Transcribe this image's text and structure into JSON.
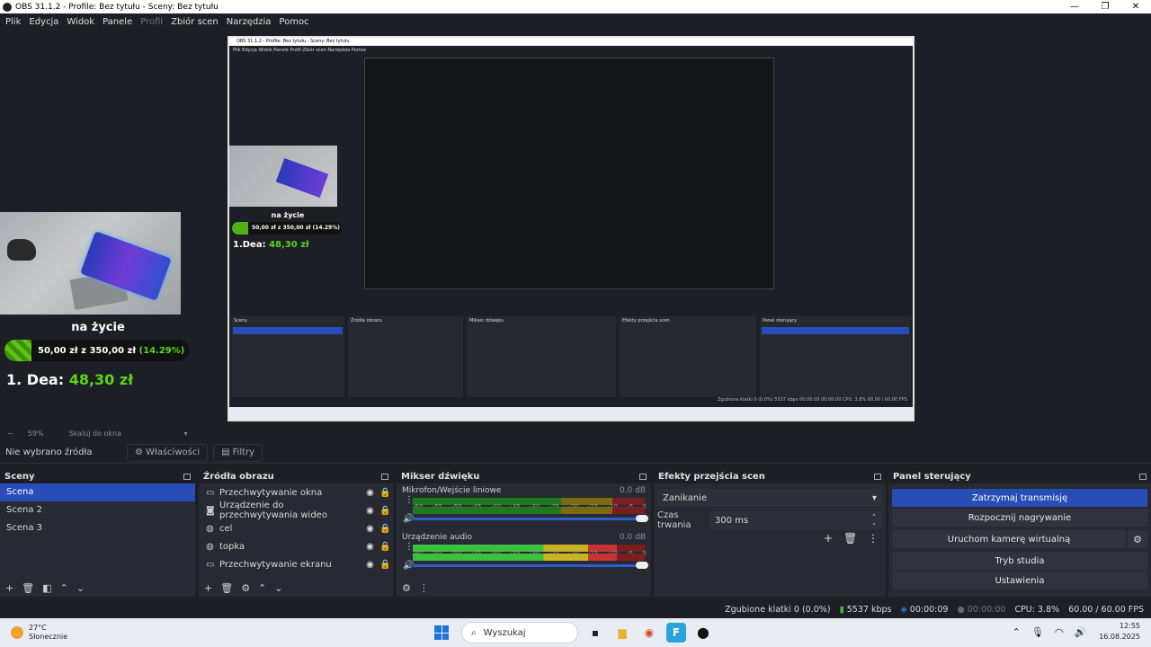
{
  "window": {
    "title": "OBS 31.1.2 - Profile: Bez tytułu - Sceny: Bez tytułu"
  },
  "menu": [
    "Plik",
    "Edycja",
    "Widok",
    "Panele",
    "Profil",
    "Zbiór scen",
    "Narzędzia",
    "Pomoc"
  ],
  "overlay": {
    "live_label": "na życie",
    "goal_current": "50,00 zł",
    "goal_sep": "z",
    "goal_target": "350,00 zł",
    "goal_pct": "(14.29%)",
    "donor_rank": "1.",
    "donor_name": "Dea:",
    "donor_amount": "48,30 zł"
  },
  "nested": {
    "title": "OBS 31.1.2 - Profile: Bez tytułu - Sceny: Bez tytułu",
    "menu": "Plik   Edycja   Widok   Panele   Profil   Zbiór scen   Narzędzia   Pomoc",
    "live_label": "na życie",
    "goal_text": "50,00 zł z 350,00 zł (14.29%)",
    "donor": "1.Dea:",
    "donor_amount": "48,30 zł",
    "status": "Zgubione klatki 0 (0.0%)   5537 kbps   00:00:09   00:00:00   CPU: 3.8%   60.00 / 60.00 FPS"
  },
  "scale": {
    "minus": "−",
    "zoom": "59%",
    "fit": "Skaluj do okna",
    "caret": "▾"
  },
  "source_toolbar": {
    "no_source": "Nie wybrano źródła",
    "properties": "Właściwości",
    "filters": "Filtry"
  },
  "scenes": {
    "title": "Sceny",
    "items": [
      "Scena",
      "Scena 2",
      "Scena 3"
    ],
    "active_index": 0
  },
  "sources": {
    "title": "Źródła obrazu",
    "items": [
      {
        "label": "Przechwytywanie okna",
        "icon": "window-icon"
      },
      {
        "label": "Urządzenie do przechwytywania wideo",
        "icon": "camera-icon"
      },
      {
        "label": "cel",
        "icon": "globe-icon"
      },
      {
        "label": "topka",
        "icon": "globe-icon"
      },
      {
        "label": "Przechwytywanie ekranu",
        "icon": "monitor-icon"
      }
    ]
  },
  "mixer": {
    "title": "Mikser dźwięku",
    "scale": [
      "-60",
      "-55",
      "-50",
      "-45",
      "-40",
      "-35",
      "-30",
      "-25",
      "-20",
      "-15",
      "-10",
      "-5",
      "0"
    ],
    "channels": [
      {
        "name": "Mikrofon/Wejście liniowe",
        "db": "0.0 dB",
        "level": 0.0
      },
      {
        "name": "Urządzenie audio",
        "db": "0.0 dB",
        "level": 0.88
      }
    ]
  },
  "transitions": {
    "title": "Efekty przejścia scen",
    "selected": "Zanikanie",
    "duration_label": "Czas trwania",
    "duration_value": "300 ms"
  },
  "controls": {
    "title": "Panel sterujący",
    "stop_stream": "Zatrzymaj transmisję",
    "start_recording": "Rozpocznij nagrywanie",
    "virtual_cam": "Uruchom kamerę wirtualną",
    "studio_mode": "Tryb studia",
    "settings": "Ustawienia"
  },
  "status": {
    "dropped": "Zgubione klatki 0 (0.0%)",
    "bitrate": "5537 kbps",
    "stream_time": "00:00:09",
    "rec_time": "00:00:00",
    "cpu": "CPU: 3.8%",
    "fps": "60.00 / 60.00 FPS"
  },
  "taskbar": {
    "temp": "27°C",
    "weather": "Słonecznie",
    "search_placeholder": "Wyszukaj",
    "time": "12:55",
    "date": "16.08.2025"
  },
  "colors": {
    "accent": "#284cb8",
    "bg": "#1d1f26",
    "dock": "#272a33",
    "green": "#5ed31c"
  }
}
